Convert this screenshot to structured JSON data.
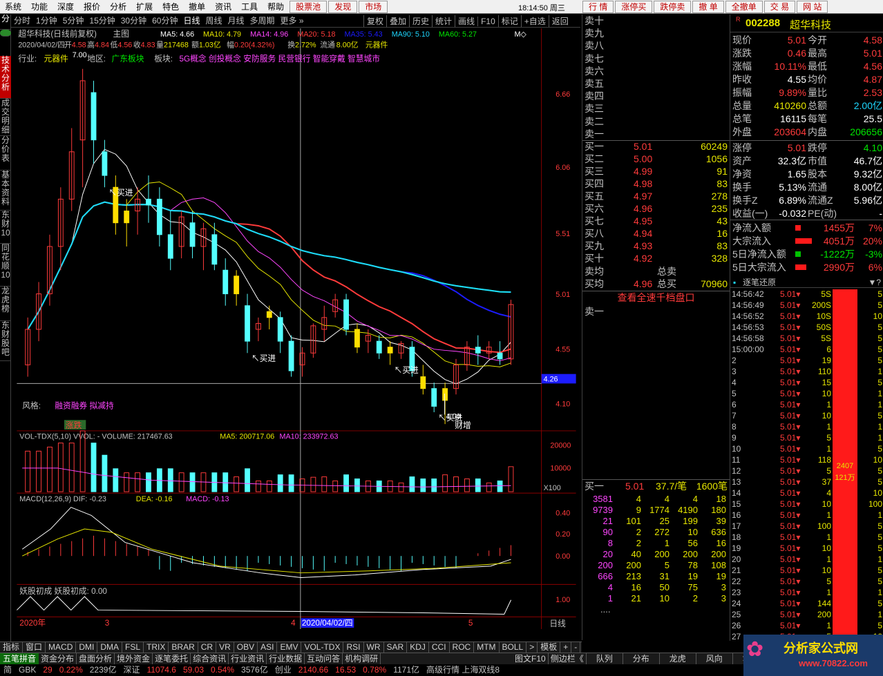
{
  "menu": {
    "items": [
      "系统",
      "功能",
      "深度",
      "报价",
      "分析",
      "扩展",
      "特色",
      "撤单",
      "资讯",
      "工具",
      "帮助"
    ],
    "red_items": [
      "股票池",
      "发现",
      "市场"
    ],
    "time": "18:14:50 周三",
    "right_buttons": [
      "行 情",
      "涨停买",
      "跌停卖",
      "撤 单",
      "全撤单",
      "交 易",
      "网 站"
    ]
  },
  "toolbar": {
    "periods": [
      "分时",
      "1分钟",
      "5分钟",
      "15分钟",
      "30分钟",
      "60分钟",
      "日线",
      "周线",
      "月线",
      "多周期",
      "更多 »"
    ],
    "active": "日线",
    "actions": [
      "复权",
      "叠加",
      "历史",
      "统计",
      "画线",
      "F10",
      "标记",
      "+自选",
      "返回"
    ]
  },
  "left_tabs": [
    "技术分析",
    "成交明细",
    "分价表",
    "基本资料",
    "东财10",
    "同花顺10",
    "龙虎榜",
    "东财股吧"
  ],
  "chart": {
    "title": "超华科技(日线前复权)",
    "main": "主图",
    "ma": [
      {
        "label": "MA5:",
        "value": "4.66",
        "color": "#ffffff"
      },
      {
        "label": "MA10:",
        "value": "4.79",
        "color": "#e6e600"
      },
      {
        "label": "MA14:",
        "value": "4.96",
        "color": "#ff46ff"
      },
      {
        "label": "MA20:",
        "value": "5.18",
        "color": "#ff3b3b"
      },
      {
        "label": "MA35:",
        "value": "5.43",
        "color": "#1c1cff"
      },
      {
        "label": "MA90:",
        "value": "5.10",
        "color": "#1ed7ff"
      },
      {
        "label": "MA60:",
        "value": "5.27",
        "color": "#00e600"
      }
    ],
    "dayline": {
      "date": "2020/04/02/四",
      "open_l": "开",
      "open": "4.58",
      "high_l": "高",
      "high": "4.84",
      "low_l": "低",
      "low": "4.56",
      "close_l": "收",
      "close": "4.83",
      "vol_l": "量",
      "vol": "217468",
      "amt_l": "额",
      "amt": "1.03亿",
      "chg_l": "幅",
      "chg": "0.20(4.32%)",
      "turn_l": "换",
      "turn": "2.72%",
      "flow_l": "流通",
      "flow": "8.00亿",
      "ind": "元器件"
    },
    "industry_l": "行业:",
    "industry": "元器件",
    "area_l": "地区:",
    "area": "广东板块",
    "block_l": "板块:",
    "block": "5G概念 创投概念 安防服务 民营银行 智能穿戴 智慧城市",
    "style_l": "风格:",
    "style": "融资融券 拟减持",
    "zhangdie": "涨跌",
    "caizeng": "财增",
    "low_mark": "4.00",
    "top_mark": "7.00",
    "buy_label": "买进",
    "price_axis": [
      "6.66",
      "6.06",
      "5.51",
      "5.01",
      "4.55",
      "4.10"
    ],
    "cross_price": "4.26",
    "vol_title": "VOL-TDX(5,10) VVOL: -  VOLUME: 217467.63",
    "vol_ma5": "MA5: 200717.06",
    "vol_ma10": "MA10: 233972.63",
    "vol_axis": [
      "20000",
      "10000"
    ],
    "vol_unit": "X100",
    "macd_title": "MACD(12,26,9) DIF: -0.23",
    "macd_dea": "DEA: -0.16",
    "macd_macd": "MACD: -0.13",
    "macd_axis": [
      "0.40",
      "0.20",
      "0.00"
    ],
    "yg_title": "妖股初成  妖股初成: 0.00",
    "yg_axis": "1.00",
    "time_axis": [
      "2020年",
      "3",
      "4",
      "5"
    ],
    "time_cursor": "2020/04/02/四",
    "period_label": "日线"
  },
  "chart_data": {
    "type": "candlestick",
    "title": "超华科技(日线前复权)",
    "ylim": [
      4.0,
      7.0
    ],
    "ohlc": [
      [
        4.5,
        4.9,
        4.4,
        4.8
      ],
      [
        4.8,
        5.2,
        4.7,
        5.1
      ],
      [
        5.1,
        5.6,
        5.0,
        5.5
      ],
      [
        5.5,
        6.0,
        5.3,
        5.9
      ],
      [
        5.9,
        6.5,
        5.8,
        6.3
      ],
      [
        6.4,
        7.0,
        6.0,
        6.9
      ],
      [
        6.8,
        6.9,
        6.2,
        6.4
      ],
      [
        6.3,
        6.4,
        6.0,
        6.1
      ],
      [
        6.0,
        6.1,
        5.6,
        5.7
      ],
      [
        5.7,
        5.9,
        5.5,
        5.8
      ],
      [
        5.8,
        6.0,
        5.6,
        5.9
      ],
      [
        5.9,
        6.1,
        5.7,
        5.85
      ],
      [
        5.9,
        6.0,
        5.5,
        5.6
      ],
      [
        5.6,
        5.8,
        5.3,
        5.4
      ],
      [
        5.5,
        5.8,
        5.4,
        5.75
      ],
      [
        5.7,
        5.8,
        5.4,
        5.5
      ],
      [
        5.5,
        5.7,
        5.3,
        5.65
      ],
      [
        5.6,
        5.7,
        5.3,
        5.35
      ],
      [
        5.3,
        5.4,
        5.0,
        5.1
      ],
      [
        5.1,
        5.3,
        5.0,
        5.25
      ],
      [
        5.0,
        5.1,
        4.6,
        4.7
      ],
      [
        4.8,
        4.9,
        4.7,
        4.85
      ],
      [
        4.9,
        5.0,
        4.8,
        4.95
      ],
      [
        4.9,
        4.95,
        4.6,
        4.7
      ],
      [
        4.7,
        4.75,
        4.4,
        4.45
      ],
      [
        4.5,
        4.65,
        4.4,
        4.6
      ],
      [
        4.6,
        4.85,
        4.56,
        4.83
      ],
      [
        4.8,
        5.0,
        4.7,
        4.9
      ],
      [
        4.95,
        5.1,
        4.9,
        5.05
      ],
      [
        5.05,
        5.1,
        4.75,
        4.8
      ],
      [
        4.8,
        4.85,
        4.6,
        4.65
      ],
      [
        4.7,
        4.8,
        4.6,
        4.75
      ],
      [
        4.7,
        4.75,
        4.55,
        4.6
      ],
      [
        4.6,
        4.7,
        4.5,
        4.65
      ],
      [
        4.6,
        4.7,
        4.55,
        4.68
      ],
      [
        4.65,
        4.7,
        4.4,
        4.45
      ],
      [
        4.4,
        4.5,
        4.25,
        4.3
      ],
      [
        4.3,
        4.35,
        4.1,
        4.15
      ],
      [
        4.2,
        4.35,
        4.0,
        4.3
      ],
      [
        4.3,
        4.55,
        4.25,
        4.5
      ],
      [
        4.5,
        4.7,
        4.45,
        4.65
      ],
      [
        4.65,
        4.75,
        4.5,
        4.6
      ],
      [
        4.6,
        4.7,
        4.55,
        4.65
      ],
      [
        4.6,
        4.7,
        4.5,
        4.55
      ],
      [
        4.55,
        5.05,
        4.5,
        5.01
      ]
    ]
  },
  "quote": {
    "code": "002288",
    "name": "超华科技",
    "sell_labels": [
      "卖十",
      "卖九",
      "卖八",
      "卖七",
      "卖六",
      "卖五",
      "卖四",
      "卖三",
      "卖二",
      "卖一"
    ],
    "buys": [
      {
        "l": "买一",
        "p": "5.01",
        "v": "60249"
      },
      {
        "l": "买二",
        "p": "5.00",
        "v": "1056"
      },
      {
        "l": "买三",
        "p": "4.99",
        "v": "91"
      },
      {
        "l": "买四",
        "p": "4.98",
        "v": "83"
      },
      {
        "l": "买五",
        "p": "4.97",
        "v": "278"
      },
      {
        "l": "买六",
        "p": "4.96",
        "v": "235"
      },
      {
        "l": "买七",
        "p": "4.95",
        "v": "43"
      },
      {
        "l": "买八",
        "p": "4.94",
        "v": "16"
      },
      {
        "l": "买九",
        "p": "4.93",
        "v": "83"
      },
      {
        "l": "买十",
        "p": "4.92",
        "v": "328"
      }
    ],
    "avg_buy_l": "买均",
    "avg_sell_l": "卖均",
    "total_sell_l": "总卖",
    "total_buy_l": "总买",
    "avg_buy": "4.96",
    "total_buy": "70960",
    "full_link": "查看全速千档盘口",
    "sell1": "卖一",
    "fbuy": {
      "l": "买一",
      "p": "5.01",
      "per": "37.7/笔",
      "n": "1600笔"
    },
    "ftable": [
      [
        "3581",
        "4",
        "4",
        "4",
        "18"
      ],
      [
        "9739",
        "9",
        "1774",
        "4190",
        "180"
      ],
      [
        "21",
        "101",
        "25",
        "199",
        "39"
      ],
      [
        "90",
        "2",
        "272",
        "10",
        "636"
      ],
      [
        "8",
        "2",
        "1",
        "56",
        "16"
      ],
      [
        "20",
        "40",
        "200",
        "200",
        "200"
      ],
      [
        "200",
        "200",
        "5",
        "78",
        "108"
      ],
      [
        "666",
        "213",
        "31",
        "19",
        "19"
      ],
      [
        "4",
        "16",
        "50",
        "75",
        "3"
      ],
      [
        "1",
        "21",
        "10",
        "2",
        "3"
      ],
      [
        "....",
        "",
        "",
        "",
        ""
      ]
    ]
  },
  "info": {
    "rows": [
      [
        "现价",
        "5.01",
        "今开",
        "4.58"
      ],
      [
        "涨跌",
        "0.46",
        "最高",
        "5.01"
      ],
      [
        "涨幅",
        "10.11%",
        "最低",
        "4.56"
      ],
      [
        "昨收",
        "4.55",
        "均价",
        "4.87"
      ],
      [
        "振幅",
        "9.89%",
        "量比",
        "2.53"
      ],
      [
        "总量",
        "410260",
        "总额",
        "2.00亿"
      ],
      [
        "总笔",
        "16115",
        "每笔",
        "25.5"
      ],
      [
        "外盘",
        "203604",
        "内盘",
        "206656"
      ],
      [
        "涨停",
        "5.01",
        "跌停",
        "4.10"
      ],
      [
        "资产",
        "32.3亿",
        "市值",
        "46.7亿"
      ],
      [
        "净资",
        "1.65",
        "股本",
        "9.32亿"
      ],
      [
        "换手",
        "5.13%",
        "流通",
        "8.00亿"
      ],
      [
        "换手Z",
        "6.89%",
        "流通Z",
        "5.96亿"
      ],
      [
        "收益(一)",
        "-0.032",
        "PE(动)",
        "-"
      ]
    ],
    "flows": [
      [
        "净流入额",
        "1455万",
        "7%"
      ],
      [
        "大宗流入",
        "4051万",
        "20%"
      ],
      [
        "5日净流入额",
        "-1222万",
        "-3%"
      ],
      [
        "5日大宗流入",
        "2990万",
        "6%"
      ]
    ],
    "ticks_title": "逐笔还原",
    "ticks": [
      [
        "14:56:42",
        "5.01",
        "5S"
      ],
      [
        "14:56:49",
        "5.01",
        "200S"
      ],
      [
        "14:56:52",
        "5.01",
        "10S"
      ],
      [
        "14:56:53",
        "5.01",
        "50S"
      ],
      [
        "14:56:58",
        "5.01",
        "5S"
      ],
      [
        "15:00:00",
        "5.01",
        "6"
      ],
      [
        "2",
        "5.01",
        "19"
      ],
      [
        "3",
        "5.01",
        "110"
      ],
      [
        "4",
        "5.01",
        "15"
      ],
      [
        "5",
        "5.01",
        "10"
      ],
      [
        "6",
        "5.01",
        "1"
      ],
      [
        "7",
        "5.01",
        "10"
      ],
      [
        "8",
        "5.01",
        "1"
      ],
      [
        "9",
        "5.01",
        "5"
      ],
      [
        "10",
        "5.01",
        "1"
      ],
      [
        "11",
        "5.01",
        "118"
      ],
      [
        "12",
        "5.01",
        "5"
      ],
      [
        "13",
        "5.01",
        "37"
      ],
      [
        "14",
        "5.01",
        "4"
      ],
      [
        "15",
        "5.01",
        "10"
      ],
      [
        "16",
        "5.01",
        "1"
      ],
      [
        "17",
        "5.01",
        "100"
      ],
      [
        "18",
        "5.01",
        "1"
      ],
      [
        "19",
        "5.01",
        "10"
      ],
      [
        "20",
        "5.01",
        "1"
      ],
      [
        "21",
        "5.01",
        "10"
      ],
      [
        "22",
        "5.01",
        "5"
      ],
      [
        "23",
        "5.01",
        "1"
      ],
      [
        "24",
        "5.01",
        "144"
      ],
      [
        "25",
        "5.01",
        "200"
      ],
      [
        "26",
        "5.01",
        "1"
      ],
      [
        "27",
        "5.01",
        "5"
      ]
    ],
    "ticks_right": [
      "5",
      "5",
      "10",
      "5",
      "5",
      "5",
      "5",
      "1",
      "5",
      "1",
      "1",
      "5",
      "1",
      "1",
      "5",
      "10",
      "5",
      "5",
      "10",
      "100",
      "1",
      "5",
      "5",
      "5",
      "1",
      "5",
      "5",
      "1",
      "5",
      "1",
      "5",
      "10"
    ],
    "bigbar_1": "2407",
    "bigbar_2": "121万"
  },
  "bottom_tabs": [
    "指标",
    "窗口",
    "MACD",
    "DMI",
    "DMA",
    "FSL",
    "TRIX",
    "BRAR",
    "CR",
    "VR",
    "OBV",
    "ASI",
    "EMV",
    "VOL-TDX",
    "RSI",
    "WR",
    "SAR",
    "KDJ",
    "CCI",
    "ROC",
    "MTM",
    "BOLL",
    ">",
    "模板",
    "+",
    "-"
  ],
  "status": {
    "five_pen": "五笔拼音",
    "fund_tabs": [
      "资金分布",
      "盘面分析",
      "境外资金",
      "逐笔委托",
      "综合资讯",
      "行业资讯",
      "行业数据",
      "互动问答",
      "机构调研"
    ],
    "right_tabs": [
      "图文F10",
      "侧边栏《",
      "队列",
      "分布",
      "龙虎",
      "风向",
      "笔"
    ],
    "line2": [
      "简",
      "GBK",
      "29",
      "0.22%",
      "2239亿",
      "深证",
      "11074.6",
      "59.03",
      "0.54%",
      "3576亿",
      "创业",
      "2140.66",
      "16.53",
      "0.78%",
      "1171亿",
      "高级行情 上海双线8"
    ]
  },
  "logo": {
    "main": "分析家公式网",
    "url": "www.70822.com"
  }
}
